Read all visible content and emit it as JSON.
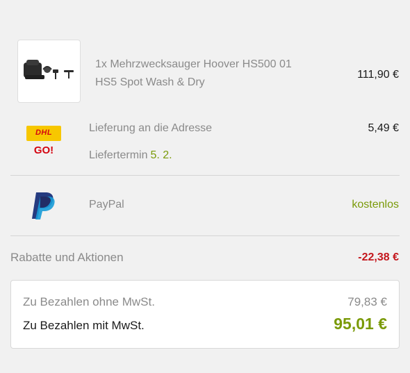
{
  "product": {
    "image_icon": "vacuum-cleaner-icon",
    "name": "1x Mehrzwecksauger Hoover HS500 01 HS5 Spot Wash & Dry",
    "price": "111,90 €"
  },
  "shipping": {
    "logo_icon": "dhl-go-logo",
    "logo_text": "DHL",
    "logo_subtext": "GO!",
    "label": "Lieferung an die Adresse",
    "price": "5,49 €",
    "date_label": "Liefertermin",
    "date_value": "5. 2."
  },
  "payment": {
    "logo_icon": "paypal-logo",
    "label": "PayPal",
    "price": "kostenlos"
  },
  "discounts": {
    "label": "Rabatte und Aktionen",
    "value": "-22,38 €"
  },
  "totals": {
    "net_label": "Zu Bezahlen ohne MwSt.",
    "net_value": "79,83 €",
    "gross_label": "Zu Bezahlen mit MwSt.",
    "gross_value": "95,01 €"
  },
  "colors": {
    "background": "#f1f1f1",
    "accent_green": "#7a9a08",
    "discount_red": "#c4161c",
    "dhl_yellow": "#f7c700",
    "dhl_red": "#d40511",
    "paypal_dark": "#253b80",
    "paypal_light": "#179bd7"
  }
}
